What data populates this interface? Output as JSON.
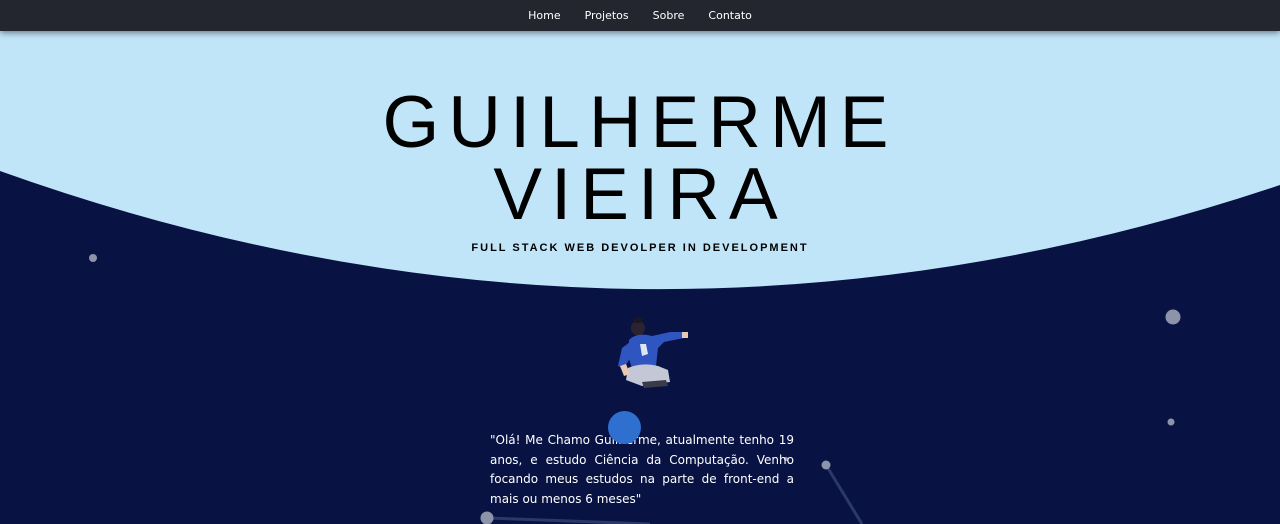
{
  "nav": {
    "items": [
      {
        "label": "Home"
      },
      {
        "label": "Projetos"
      },
      {
        "label": "Sobre"
      },
      {
        "label": "Contato"
      }
    ]
  },
  "hero": {
    "first_name": "GUILHERME",
    "last_name": "VIEIRA",
    "subtitle": "FULL STACK WEB DEVOLPER IN DEVELOPMENT"
  },
  "about": {
    "bio": "\"Olá! Me Chamo Guilherme, atualmente tenho 19 anos, e estudo Ciência da Computação. Venho focando meus estudos na parte de front-end a mais ou menos 6 meses\""
  },
  "colors": {
    "navbar": "#23262f",
    "hero_light": "#c1e5f8",
    "background_dark": "#081344",
    "particle_accent": "#2f6fd0",
    "particle_gray": "#8d93a8"
  }
}
